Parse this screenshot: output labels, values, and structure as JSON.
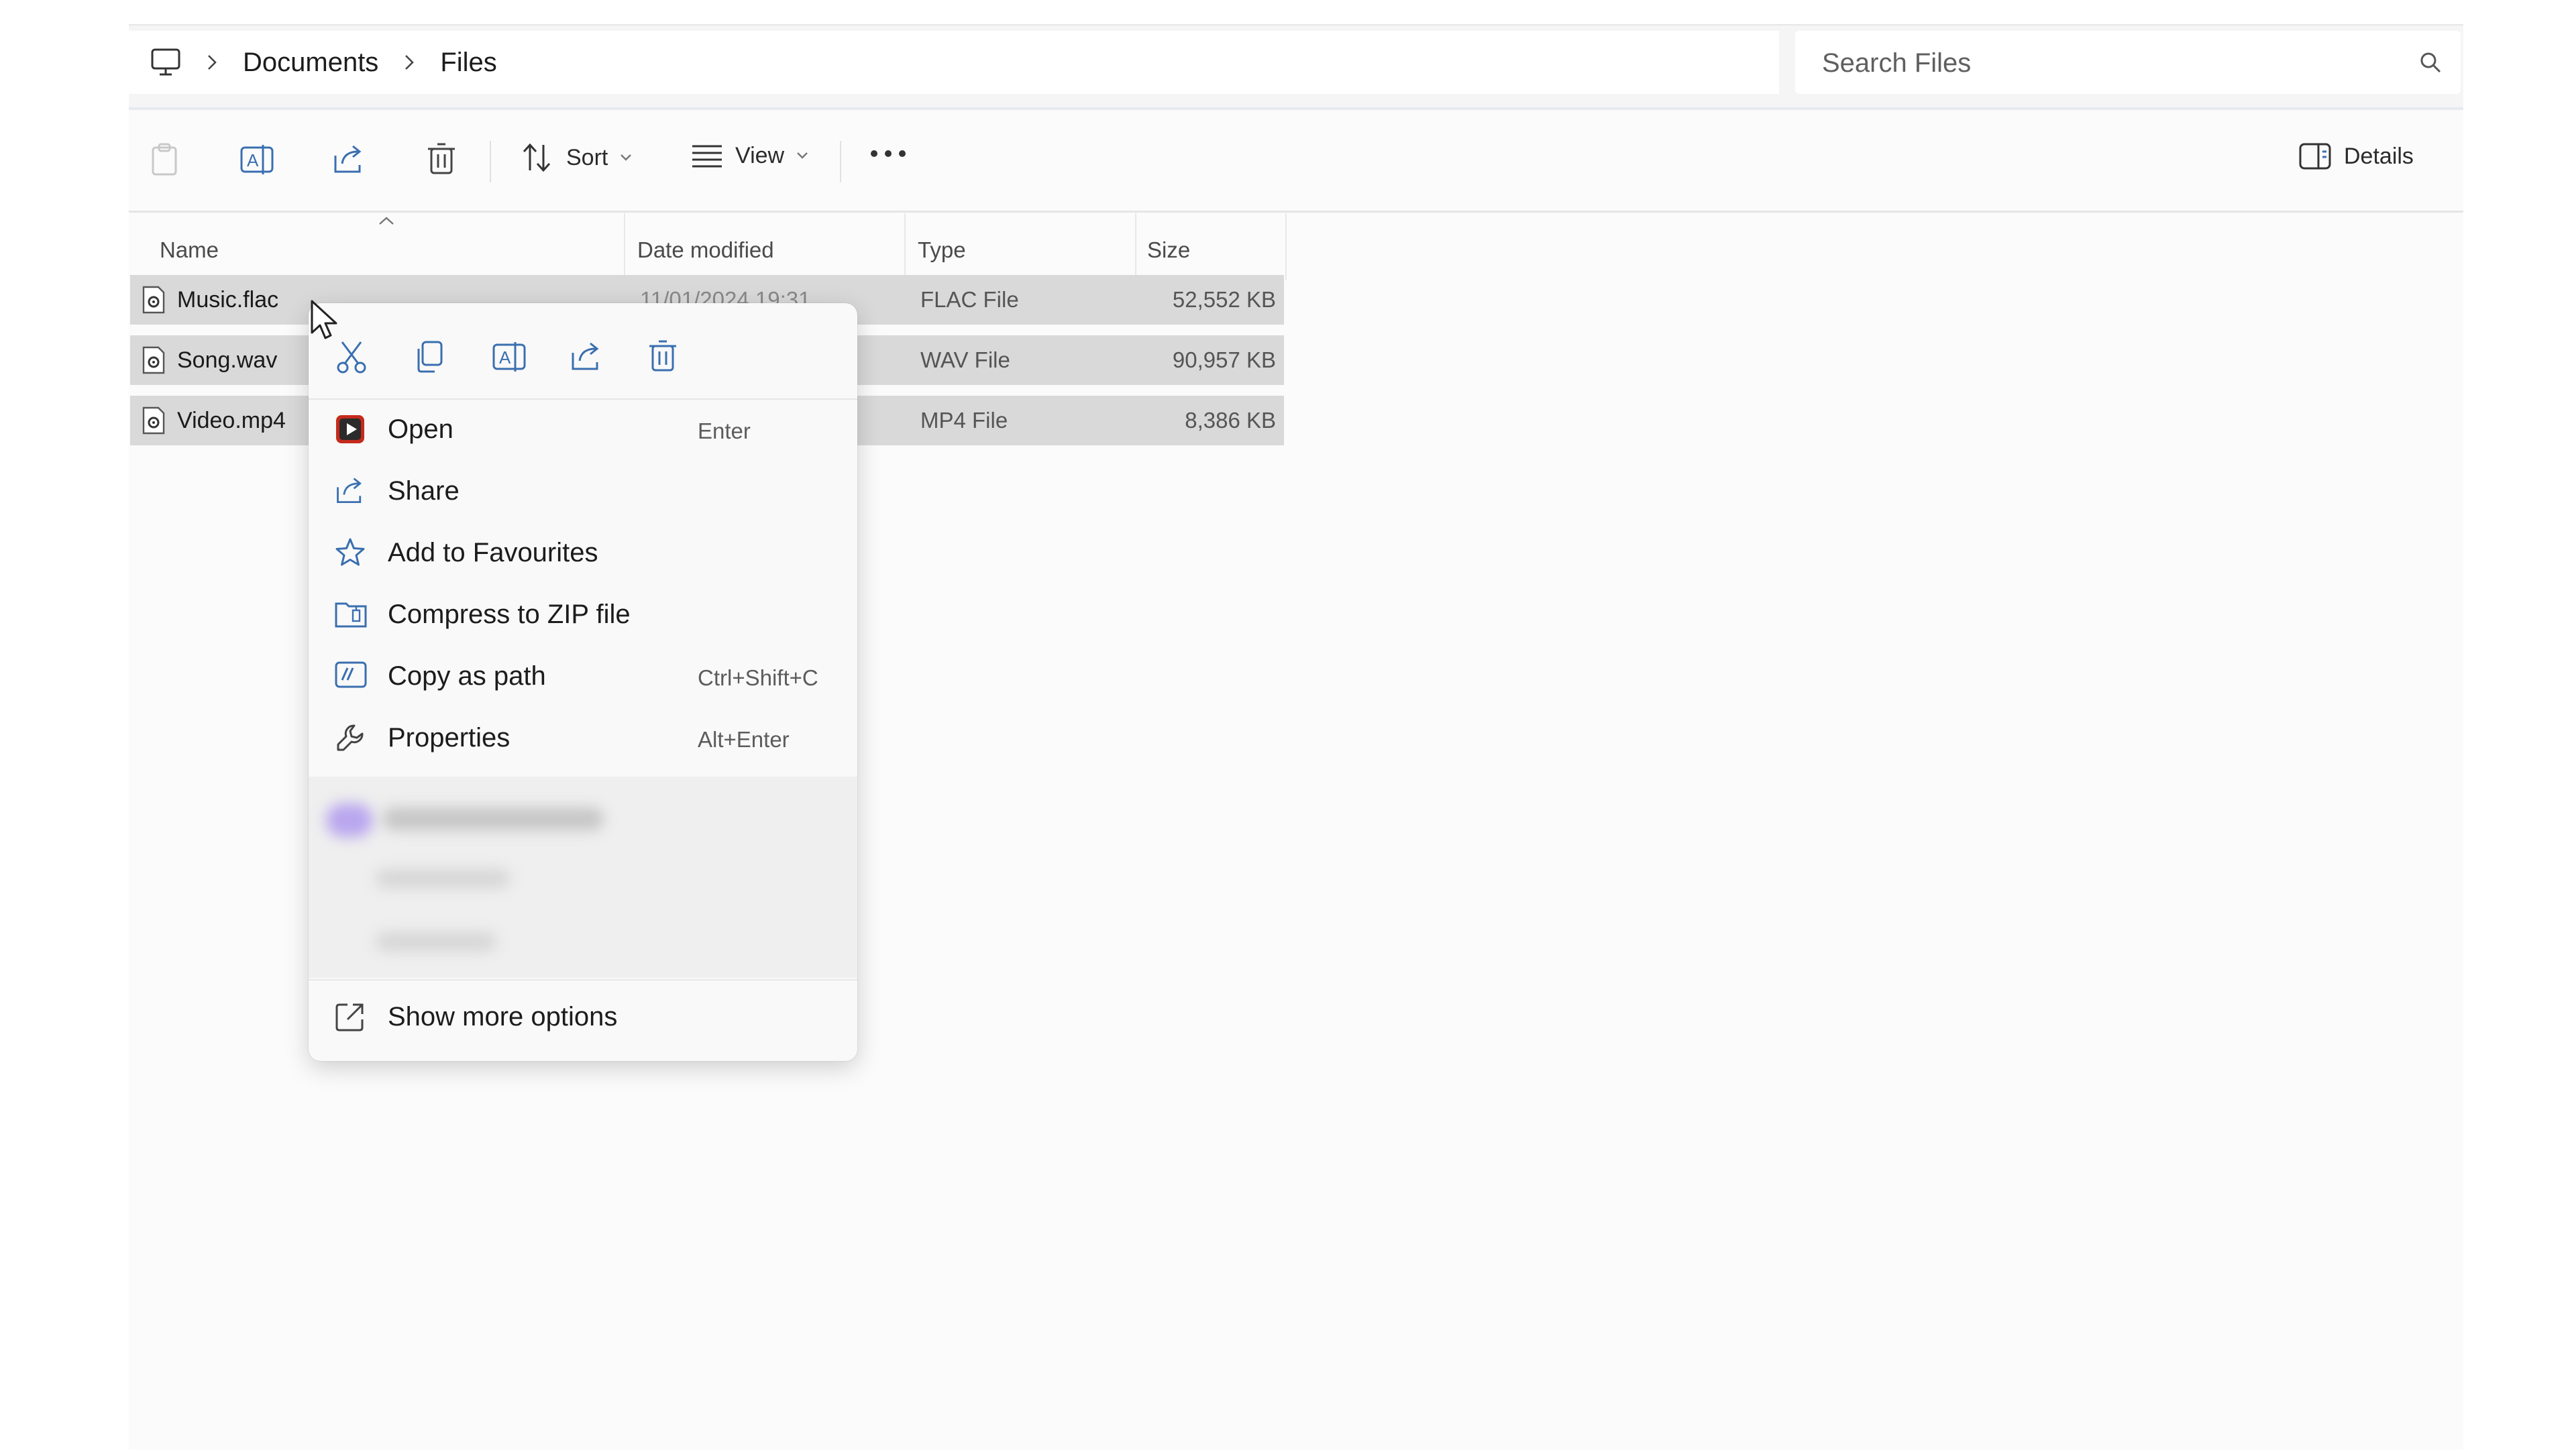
{
  "breadcrumb": {
    "items": [
      "Documents",
      "Files"
    ]
  },
  "search": {
    "placeholder": "Search Files"
  },
  "toolbar": {
    "sort_label": "Sort",
    "view_label": "View",
    "details_label": "Details"
  },
  "columns": {
    "name": "Name",
    "date": "Date modified",
    "type": "Type",
    "size": "Size"
  },
  "files": [
    {
      "name": "Music.flac",
      "date": "11/01/2024 19:31",
      "type": "FLAC File",
      "size": "52,552 KB"
    },
    {
      "name": "Song.wav",
      "date": "",
      "type": "WAV File",
      "size": "90,957 KB"
    },
    {
      "name": "Video.mp4",
      "date": "",
      "type": "MP4 File",
      "size": "8,386 KB"
    }
  ],
  "context_menu": {
    "items": [
      {
        "label": "Open",
        "shortcut": "Enter",
        "icon": "open-app-icon"
      },
      {
        "label": "Share",
        "shortcut": "",
        "icon": "share-icon"
      },
      {
        "label": "Add to Favourites",
        "shortcut": "",
        "icon": "star-icon"
      },
      {
        "label": "Compress to ZIP file",
        "shortcut": "",
        "icon": "zip-icon"
      },
      {
        "label": "Copy as path",
        "shortcut": "Ctrl+Shift+C",
        "icon": "copy-path-icon"
      },
      {
        "label": "Properties",
        "shortcut": "Alt+Enter",
        "icon": "wrench-icon"
      }
    ],
    "more_options": "Show more options"
  },
  "colors": {
    "selection": "#d9d9d9",
    "menu_bg": "#f9f9f9",
    "open_icon_red": "#c42b1c"
  }
}
